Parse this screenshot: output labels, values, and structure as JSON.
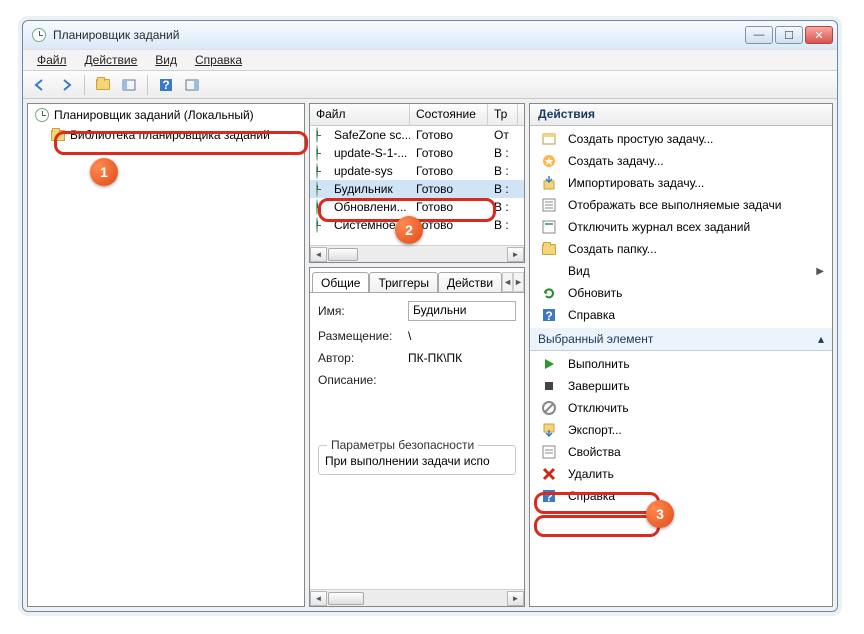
{
  "title": "Планировщик заданий",
  "menu": {
    "file": "Файл",
    "action": "Действие",
    "view": "Вид",
    "help": "Справка"
  },
  "tree": {
    "root": "Планировщик заданий (Локальный)",
    "child": "Библиотека планировщика заданий"
  },
  "grid": {
    "headers": {
      "name": "Файл",
      "state": "Состояние",
      "trigger": "Тр"
    },
    "rows": [
      {
        "name": "SafeZone sc...",
        "state": "Готово",
        "trig": "От"
      },
      {
        "name": "update-S-1-...",
        "state": "Готово",
        "trig": "В :"
      },
      {
        "name": "update-sys",
        "state": "Готово",
        "trig": "В :"
      },
      {
        "name": "Будильник",
        "state": "Готово",
        "trig": "В :"
      },
      {
        "name": "Обновлени...",
        "state": "Готово",
        "trig": "В :"
      },
      {
        "name": "Системное ...",
        "state": "Готово",
        "trig": "В :"
      }
    ]
  },
  "tabs": {
    "general": "Общие",
    "triggers": "Триггеры",
    "actions": "Действи"
  },
  "form": {
    "name_label": "Имя:",
    "name_value": "Будильни",
    "location_label": "Размещение:",
    "location_value": "\\",
    "author_label": "Автор:",
    "author_value": "ПК-ПК\\ПК",
    "desc_label": "Описание:",
    "sec_group": "Параметры безопасности",
    "sec_line": "При выполнении задачи испо"
  },
  "actions": {
    "header": "Действия",
    "section2": "Выбранный элемент",
    "items1": [
      {
        "key": "create_basic",
        "label": "Создать простую задачу...",
        "icon": "wizard"
      },
      {
        "key": "create",
        "label": "Создать задачу...",
        "icon": "new"
      },
      {
        "key": "import",
        "label": "Импортировать задачу...",
        "icon": "import"
      },
      {
        "key": "show_running",
        "label": "Отображать все выполняемые задачи",
        "icon": "list"
      },
      {
        "key": "disable_log",
        "label": "Отключить журнал всех заданий",
        "icon": "log"
      },
      {
        "key": "new_folder",
        "label": "Создать папку...",
        "icon": "folder"
      },
      {
        "key": "view",
        "label": "Вид",
        "icon": "",
        "submenu": true
      },
      {
        "key": "refresh",
        "label": "Обновить",
        "icon": "refresh"
      },
      {
        "key": "help1",
        "label": "Справка",
        "icon": "help"
      }
    ],
    "items2": [
      {
        "key": "run",
        "label": "Выполнить",
        "icon": "play"
      },
      {
        "key": "end",
        "label": "Завершить",
        "icon": "stop"
      },
      {
        "key": "disable",
        "label": "Отключить",
        "icon": "disable"
      },
      {
        "key": "export",
        "label": "Экспорт...",
        "icon": "export"
      },
      {
        "key": "properties",
        "label": "Свойства",
        "icon": "props"
      },
      {
        "key": "delete",
        "label": "Удалить",
        "icon": "delete"
      },
      {
        "key": "help2",
        "label": "Справка",
        "icon": "help"
      }
    ]
  },
  "badges": {
    "b1": "1",
    "b2": "2",
    "b3": "3"
  }
}
